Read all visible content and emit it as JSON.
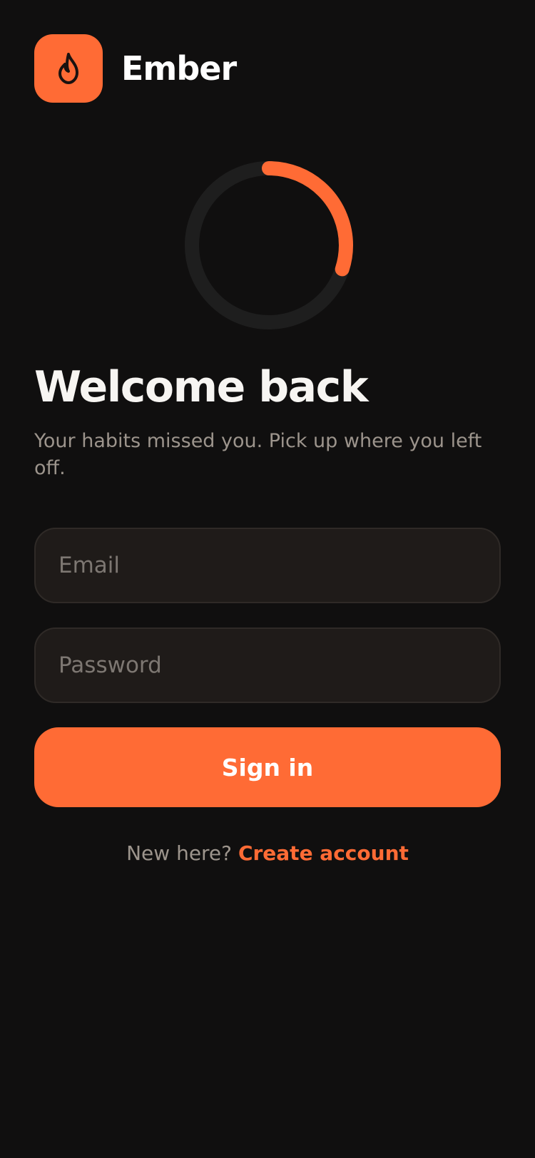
{
  "app": {
    "name": "Ember",
    "brand_color": "#ff6b35",
    "logo_icon": "flame-icon"
  },
  "progress": {
    "value": 0.3
  },
  "login": {
    "title": "Welcome back",
    "subtitle": "Your habits missed you. Pick up where you left off.",
    "email_placeholder": "Email",
    "password_placeholder": "Password",
    "signin_label": "Sign in"
  },
  "footer": {
    "prompt": "New here?",
    "link_label": "Create account"
  }
}
